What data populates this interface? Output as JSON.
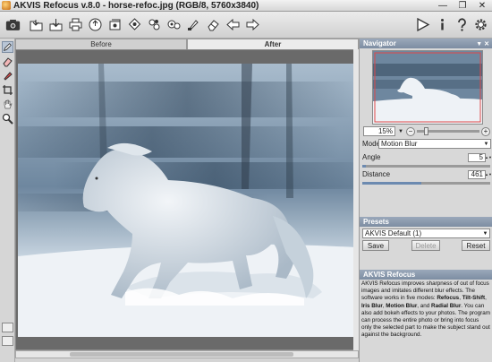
{
  "window": {
    "title": "AKVIS Refocus v.8.0 - horse-refoc.jpg (RGB/8, 5760x3840)",
    "controls": [
      "—",
      "❐",
      "✕"
    ]
  },
  "toolbar": {
    "left_icons": [
      "camera-open-icon",
      "open-icon",
      "save-icon",
      "print-icon",
      "share-icon",
      "batch-icon",
      "before-icon",
      "after-icon",
      "settings-icon",
      "brush-icon",
      "eraser-icon",
      "back-arrow-icon",
      "forward-arrow-icon"
    ],
    "right_icons": [
      "run-icon",
      "info-icon",
      "help-icon",
      "preferences-icon"
    ]
  },
  "tools": [
    "pencil-icon",
    "eraser-icon",
    "pin-icon",
    "crop-icon",
    "hand-icon",
    "zoom-icon"
  ],
  "tabs": {
    "before": "Before",
    "after": "After"
  },
  "navigator": {
    "title": "Navigator",
    "zoom_value": "15%",
    "zoom_minus": "−",
    "zoom_plus": "+"
  },
  "settings": {
    "mode_label": "Mode:",
    "mode_value": "Motion Blur",
    "angle_label": "Angle",
    "angle_value": "5",
    "angle_fraction": 0.03,
    "distance_label": "Distance",
    "distance_value": "461",
    "distance_fraction": 0.46
  },
  "presets": {
    "title": "Presets",
    "selected": "AKVIS Default (1)",
    "save_label": "Save",
    "delete_label": "Delete",
    "reset_label": "Reset"
  },
  "help": {
    "title": "AKVIS Refocus",
    "p1": "AKVIS Refocus improves sharpness of out of focus images and imitates different blur effects. The software works in five modes: ",
    "m1": "Refocus",
    "s1": ", ",
    "m2": "Tilt-Shift",
    "s2": ", ",
    "m3": "Iris Blur",
    "s3": ", ",
    "m4": "Motion Blur",
    "s4": ", and ",
    "m5": "Radial Blur",
    "p2": ". You can also add bokeh effects to your photos. The program can process the entire photo or bring into focus only the selected part to make the subject stand out against the background."
  },
  "colors": {
    "panel_header": "#7d8da2",
    "accent": "#6c8ab0"
  }
}
